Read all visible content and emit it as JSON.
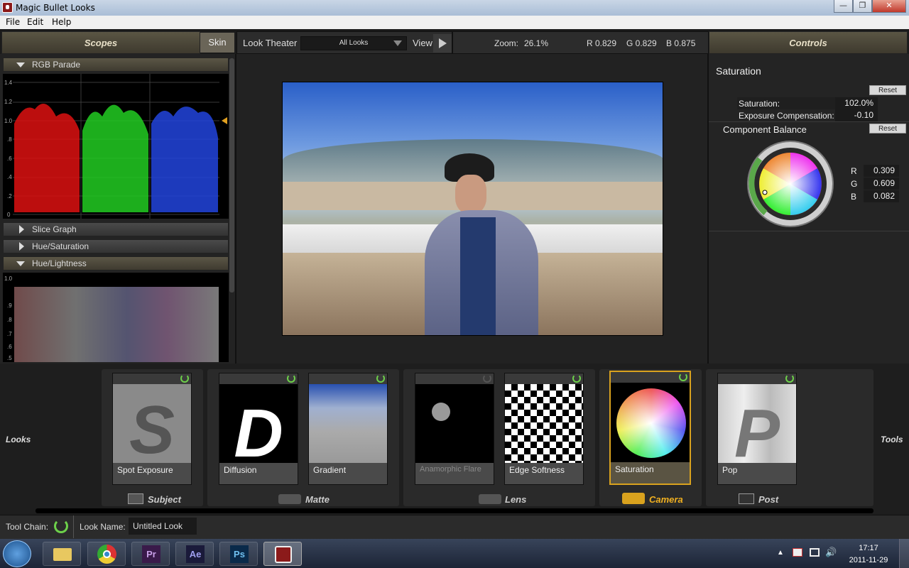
{
  "window": {
    "title": "Magic Bullet Looks",
    "min": "—",
    "max": "❐",
    "close": "✕"
  },
  "menu": [
    "File",
    "Edit",
    "Help"
  ],
  "scopes_panel": {
    "title": "Scopes",
    "skin_button": "Skin",
    "sections": [
      "RGB Parade",
      "Slice Graph",
      "Hue/Saturation",
      "Hue/Lightness"
    ],
    "rgb_axis": [
      "1.4",
      "1.2",
      "1.0",
      ".8",
      ".6",
      ".4",
      ".2",
      "0"
    ],
    "hl_axis": [
      "1.0",
      ".9",
      ".8",
      ".7",
      ".6",
      ".5"
    ]
  },
  "look_theater": {
    "label": "Look Theater",
    "dropdown": "All Looks",
    "view": "View"
  },
  "viewer_info": {
    "zoom_label": "Zoom:",
    "zoom": "26.1%",
    "r": "R 0.829",
    "g": "G 0.829",
    "b": "B 0.875"
  },
  "controls": {
    "title": "Controls",
    "section": "Saturation",
    "reset": "Reset",
    "saturation_label": "Saturation:",
    "saturation_value": "102.0%",
    "exposure_label": "Exposure Compensation:",
    "exposure_value": "-0.10",
    "balance_label": "Component Balance",
    "r_label": "R",
    "r_value": "0.309",
    "g_label": "G",
    "g_value": "0.609",
    "b_label": "B",
    "b_value": "0.082"
  },
  "tools": [
    {
      "name": "Spot Exposure",
      "letter": "S"
    },
    {
      "name": "Diffusion",
      "letter": "D"
    },
    {
      "name": "Gradient"
    },
    {
      "name": "Anamorphic Flare"
    },
    {
      "name": "Edge Softness"
    },
    {
      "name": "Saturation"
    },
    {
      "name": "Pop",
      "letter": "P"
    }
  ],
  "groups": [
    "Subject",
    "Matte",
    "Lens",
    "Camera",
    "Post"
  ],
  "side_labels": {
    "looks": "Looks",
    "tools": "Tools"
  },
  "statusbar": {
    "toolchain": "Tool Chain:",
    "look_name_label": "Look Name:",
    "look_name": "Untitled Look"
  },
  "taskbar": {
    "apps": [
      "Pr",
      "Ae",
      "Ps"
    ],
    "time": "17:17",
    "date": "2011-11-29"
  },
  "colors": {
    "accent": "#d9a21e",
    "power_green": "#6dd14a"
  }
}
